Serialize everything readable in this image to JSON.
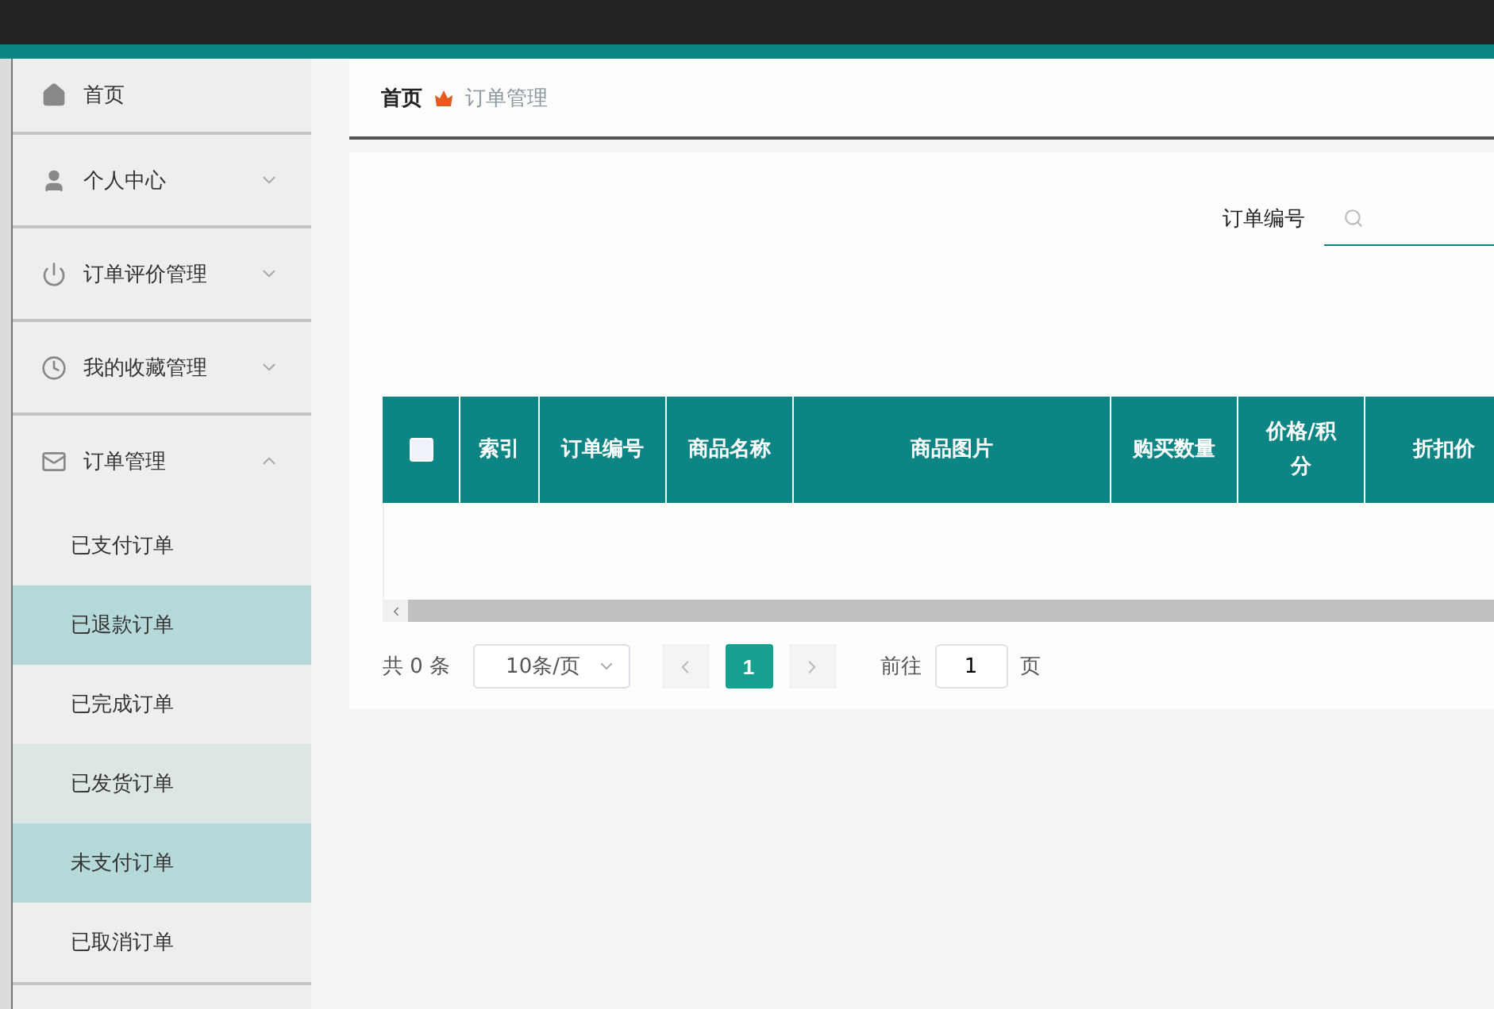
{
  "sidebar": {
    "items": [
      {
        "label": "首页"
      },
      {
        "label": "个人中心",
        "expanded": false
      },
      {
        "label": "订单评价管理",
        "expanded": false
      },
      {
        "label": "我的收藏管理",
        "expanded": false
      },
      {
        "label": "订单管理",
        "expanded": true,
        "children": [
          {
            "label": "已支付订单",
            "selected": false,
            "hovered": false
          },
          {
            "label": "已退款订单",
            "selected": true,
            "hovered": false
          },
          {
            "label": "已完成订单",
            "selected": false,
            "hovered": false
          },
          {
            "label": "已发货订单",
            "selected": false,
            "hovered": true
          },
          {
            "label": "未支付订单",
            "selected": true,
            "hovered": false
          },
          {
            "label": "已取消订单",
            "selected": false,
            "hovered": false
          }
        ]
      }
    ]
  },
  "breadcrumb": [
    "首页",
    "订单管理"
  ],
  "search": {
    "label": "订单编号"
  },
  "table": {
    "columns": [
      "索引",
      "订单编号",
      "商品名称",
      "商品图片",
      "购买数量",
      "价格/积分",
      "折扣价"
    ],
    "select_all": {
      "checked": false
    }
  },
  "pagination": {
    "total": "共 0 条",
    "page_size": "10条/页",
    "pages": [
      {
        "label": "1",
        "selected": true
      }
    ],
    "goto_label": "前往",
    "goto_value": "1",
    "page_unit": "页"
  }
}
